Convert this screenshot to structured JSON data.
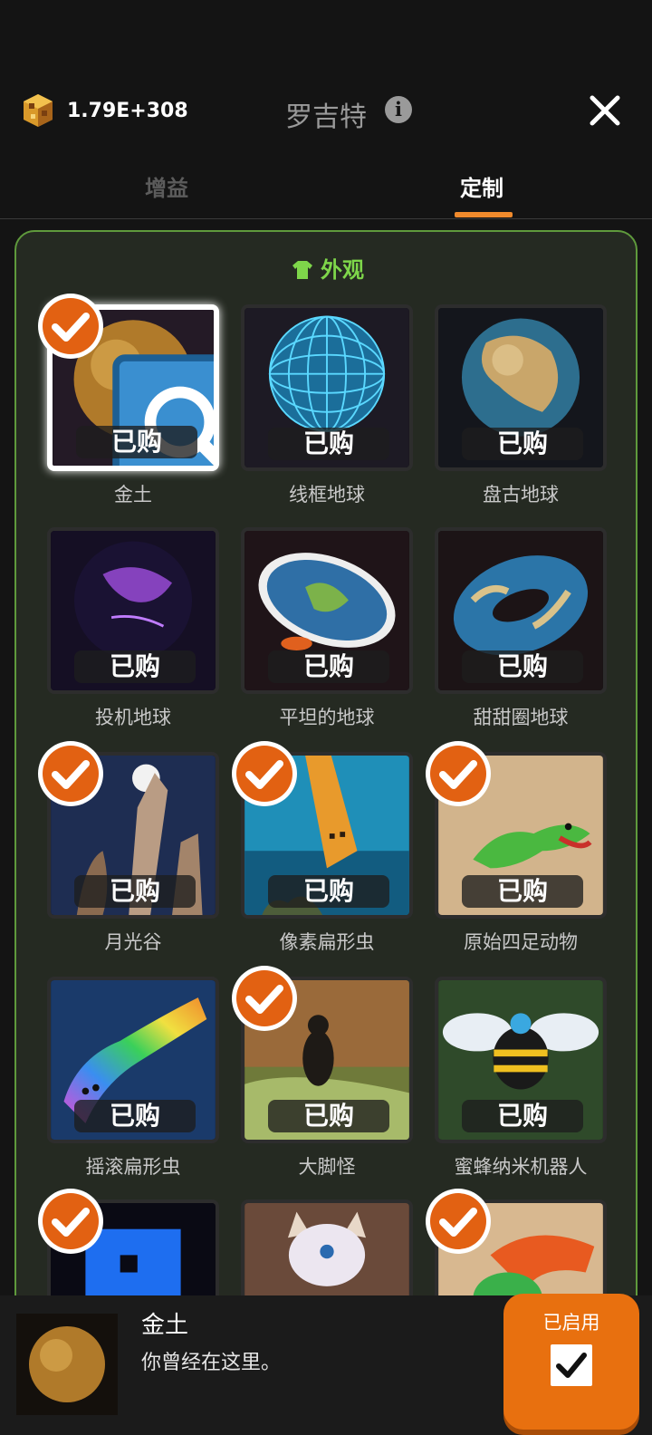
{
  "header": {
    "currency_value": "1.79E+308",
    "title": "罗吉特"
  },
  "tabs": [
    {
      "label": "增益",
      "active": false
    },
    {
      "label": "定制",
      "active": true
    }
  ],
  "section": {
    "title": "外观"
  },
  "bought_label": "已购",
  "items": [
    {
      "name": "金土",
      "checked": true,
      "selected": true
    },
    {
      "name": "线框地球",
      "checked": false
    },
    {
      "name": "盘古地球",
      "checked": false
    },
    {
      "name": "投机地球",
      "checked": false
    },
    {
      "name": "平坦的地球",
      "checked": false
    },
    {
      "name": "甜甜圈地球",
      "checked": false
    },
    {
      "name": "月光谷",
      "checked": true
    },
    {
      "name": "像素扁形虫",
      "checked": true
    },
    {
      "name": "原始四足动物",
      "checked": true
    },
    {
      "name": "摇滚扁形虫",
      "checked": false
    },
    {
      "name": "大脚怪",
      "checked": true
    },
    {
      "name": "蜜蜂纳米机器人",
      "checked": false
    },
    {
      "name": "",
      "checked": true
    },
    {
      "name": "",
      "checked": false
    },
    {
      "name": "",
      "checked": true
    }
  ],
  "bottom_bar": {
    "name": "金土",
    "description": "你曾经在这里。",
    "button_label": "已启用",
    "enabled": true
  },
  "colors": {
    "accent_orange": "#e8700f",
    "section_green": "#7ed64a",
    "panel_border": "#5f9a3c"
  }
}
